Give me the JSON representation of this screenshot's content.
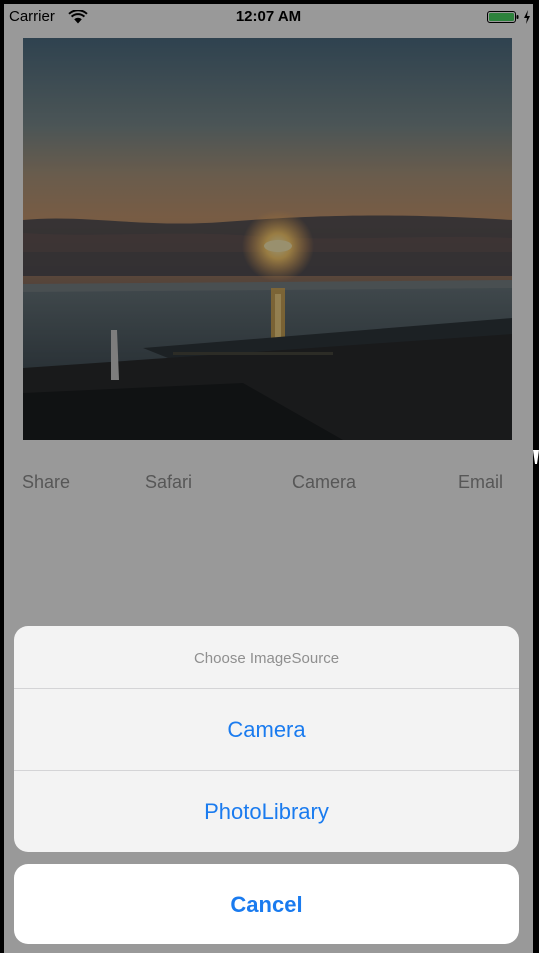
{
  "status_bar": {
    "carrier": "Carrier",
    "time": "12:07 AM",
    "wifi_icon": "wifi-icon",
    "battery_icon": "battery-charging-icon",
    "battery_level": 1.0,
    "battery_color": "#4cd964"
  },
  "photo": {
    "subject": "sunset-over-beach-photo"
  },
  "toolbar": {
    "share_label": "Share",
    "safari_label": "Safari",
    "camera_label": "Camera",
    "email_label": "Email"
  },
  "action_sheet": {
    "title": "Choose ImageSource",
    "options": [
      {
        "label": "Camera"
      },
      {
        "label": "PhotoLibrary"
      }
    ],
    "cancel_label": "Cancel",
    "accent_color": "#1a7bef"
  }
}
